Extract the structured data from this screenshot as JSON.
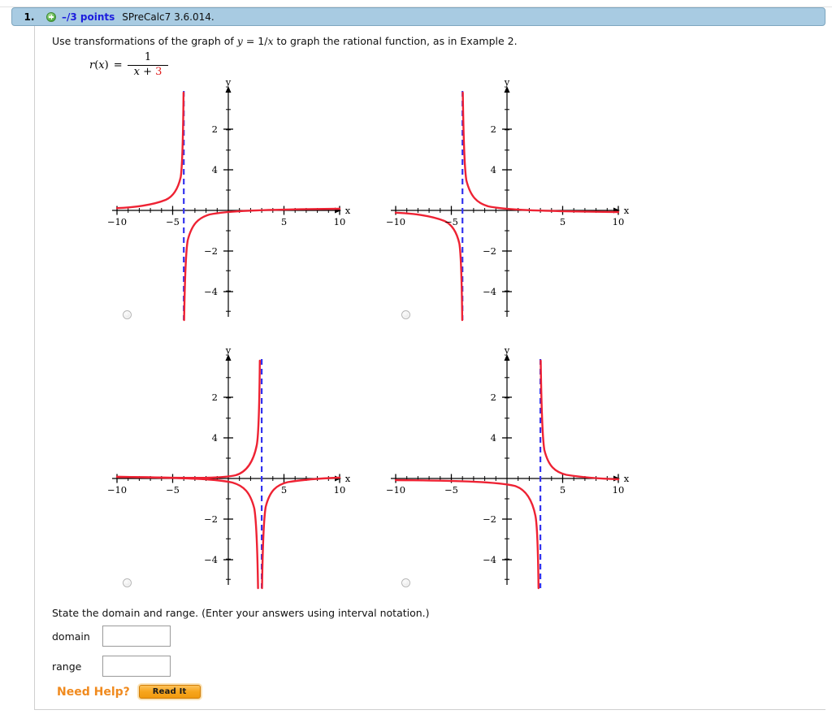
{
  "header": {
    "question_number": "1.",
    "plus_icon": "plus-circle-icon",
    "points": "–/3 points",
    "code": "SPreCalc7 3.6.014."
  },
  "prompt": {
    "line1_a": "Use transformations of the graph of ",
    "line1_y": "y",
    "line1_b": " = 1/",
    "line1_x": "x",
    "line1_c": " to graph the rational function, as in Example 2."
  },
  "formula": {
    "fname": "r",
    "arg_open": "(",
    "arg": "x",
    "arg_close": ")",
    "equals": "=",
    "numerator": "1",
    "denominator_x": "x",
    "denominator_plus": " + ",
    "denominator_const": "3",
    "const_color": "#e01b1b"
  },
  "choices": [
    {
      "id": "choice-a",
      "name": "graph-choice-a",
      "selected": false,
      "asymptote_x": -3,
      "branch": "left-up",
      "description": "Vertical asymptote x = -3; left branch rises to +infinity as x approaches -3 from the left, right branch rises from -infinity toward 0."
    },
    {
      "id": "choice-b",
      "name": "graph-choice-b",
      "selected": false,
      "asymptote_x": -3,
      "branch": "left-down",
      "description": "Vertical asymptote x = -3; left branch falls to -infinity as x approaches -3 from the left, right branch falls from +infinity toward 0."
    },
    {
      "id": "choice-c",
      "name": "graph-choice-c",
      "selected": false,
      "asymptote_x": 3,
      "branch": "left-up",
      "description": "Vertical asymptote x = 3; left branch rises to +infinity as x approaches 3 from the left, right branch rises from -infinity toward 0."
    },
    {
      "id": "choice-d",
      "name": "graph-choice-d",
      "selected": false,
      "asymptote_x": 3,
      "branch": "left-down",
      "description": "Vertical asymptote x = 3; left branch falls to -infinity as x approaches 3 from the left, right branch falls from +infinity toward 0."
    }
  ],
  "axes": {
    "xlabel": "x",
    "ylabel": "y",
    "xticks": [
      -10,
      -5,
      5,
      10
    ],
    "xtick_labels": [
      "−10",
      "−5",
      "5",
      "10"
    ],
    "yticks": [
      -4,
      -2,
      2,
      4
    ],
    "ytick_labels": [
      "−4",
      "−2",
      "2",
      "4"
    ],
    "xlim": [
      -10.8,
      10.8
    ],
    "ylim": [
      -5.4,
      5.4
    ],
    "curve_color": "#ee2233",
    "asymptote_color": "#3333ee"
  },
  "chart_data": {
    "type": "line",
    "title": "Four candidate graphs of r(x) = 1/(x + 3)",
    "xlabel": "x",
    "ylabel": "y",
    "xlim": [
      -10.8,
      10.8
    ],
    "ylim": [
      -5.4,
      5.4
    ],
    "xticks": [
      -10,
      -5,
      5,
      10
    ],
    "yticks": [
      -4,
      -2,
      2,
      4
    ],
    "grid": false,
    "legend": "none",
    "series": [
      {
        "name": "choice-a: y = -1/(x + 3)",
        "asymptote_x": -3,
        "horizontal_asymptote_y": 0,
        "sign": -1,
        "color": "#ee2233"
      },
      {
        "name": "choice-b: y = 1/(x + 3)",
        "asymptote_x": -3,
        "horizontal_asymptote_y": 0,
        "sign": 1,
        "color": "#ee2233"
      },
      {
        "name": "choice-c: y = -1/(x - 3)",
        "asymptote_x": 3,
        "horizontal_asymptote_y": 0,
        "sign": -1,
        "color": "#ee2233"
      },
      {
        "name": "choice-d: y = 1/(x - 3)",
        "asymptote_x": 3,
        "horizontal_asymptote_y": 0,
        "sign": 1,
        "color": "#ee2233"
      }
    ]
  },
  "bottom": {
    "state_text": "State the domain and range. (Enter your answers using interval notation.)",
    "domain_label": "domain",
    "domain_value": "",
    "domain_placeholder": "",
    "range_label": "range",
    "range_value": "",
    "range_placeholder": "",
    "need_help_label": "Need Help?",
    "read_it_label": "Read It"
  }
}
